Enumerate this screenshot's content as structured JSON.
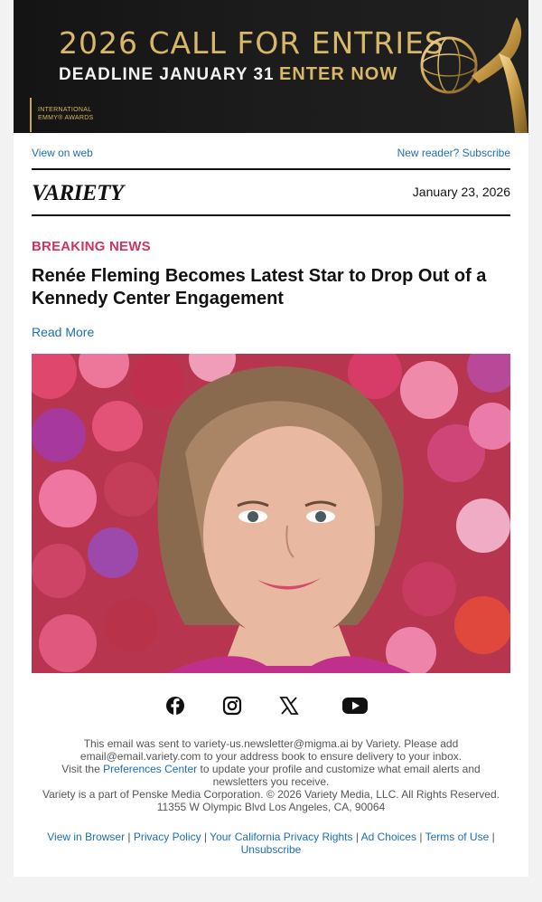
{
  "banner": {
    "headline": "2026 CALL FOR ENTRIES",
    "deadline": "DEADLINE JANUARY 31",
    "cta": "ENTER NOW",
    "logo_line1": "INTERNATIONAL",
    "logo_line2": "EMMY® AWARDS",
    "colors": {
      "gold": "#d8b766",
      "background": "#141414"
    }
  },
  "top_links": {
    "view_on_web": "View on web",
    "subscribe": "New reader? Subscribe"
  },
  "masthead": {
    "brand": "VARIETY",
    "date": "January 23, 2026"
  },
  "article": {
    "kicker": "BREAKING NEWS",
    "headline": "Renée Fleming Becomes Latest Star to Drop Out of a Kennedy Center Engagement",
    "read_more": "Read More",
    "image_alt": "Renée Fleming photo",
    "colors": {
      "kicker": "#d0345a",
      "link": "#1a6fb5"
    }
  },
  "social": {
    "icons": [
      "facebook-icon",
      "instagram-icon",
      "x-icon",
      "youtube-icon"
    ]
  },
  "footer": {
    "sent_prefix": "This email was sent to variety-us.newsletter@migma.ai by Variety. Please add email@email.variety.com to your address book to ensure delivery to your inbox.",
    "visit_prefix": "Visit the",
    "preferences_link": "Preferences Center",
    "visit_suffix": "to update your profile and customize what email alerts and newsletters you receive.",
    "copyright": "Variety is a part of Penske Media Corporation. © 2026 Variety Media, LLC. All Rights Reserved.",
    "address": "11355 W Olympic Blvd Los Angeles, CA, 90064"
  },
  "legal_links": {
    "view_in_browser": "View in Browser",
    "privacy_policy": "Privacy Policy",
    "california_rights": "Your California Privacy Rights",
    "ad_choices": "Ad Choices",
    "terms": "Terms of Use",
    "unsubscribe": "Unsubscribe",
    "separator": "|"
  }
}
